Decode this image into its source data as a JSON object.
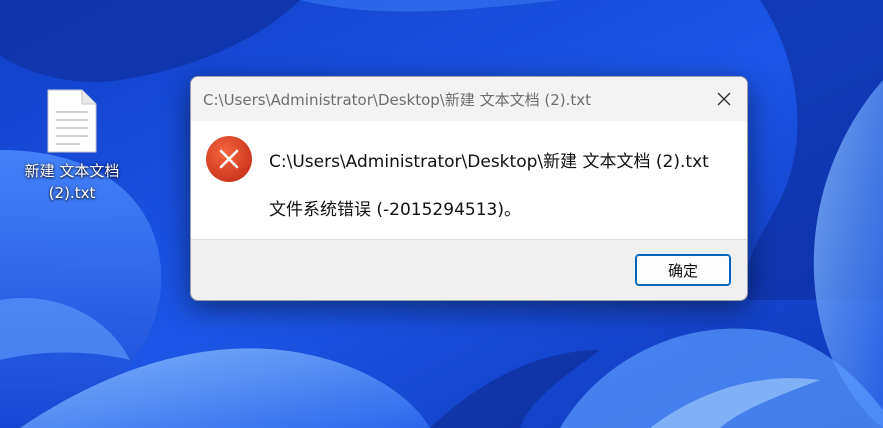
{
  "desktop": {
    "icon_name": "file-txt-icon",
    "icon_label": "新建 文本文档 (2).txt"
  },
  "dialog": {
    "title": "C:\\Users\\Administrator\\Desktop\\新建 文本文档 (2).txt",
    "close_icon": "close-icon",
    "status_icon": "error-icon",
    "message_path": "C:\\Users\\Administrator\\Desktop\\新建 文本文档 (2).txt",
    "message_error": "文件系统错误 (-2015294513)。",
    "ok_label": "确定"
  },
  "colors": {
    "wallpaper_base": "#1b49d6",
    "error_red": "#e0452b",
    "button_accent": "#0067c0"
  }
}
